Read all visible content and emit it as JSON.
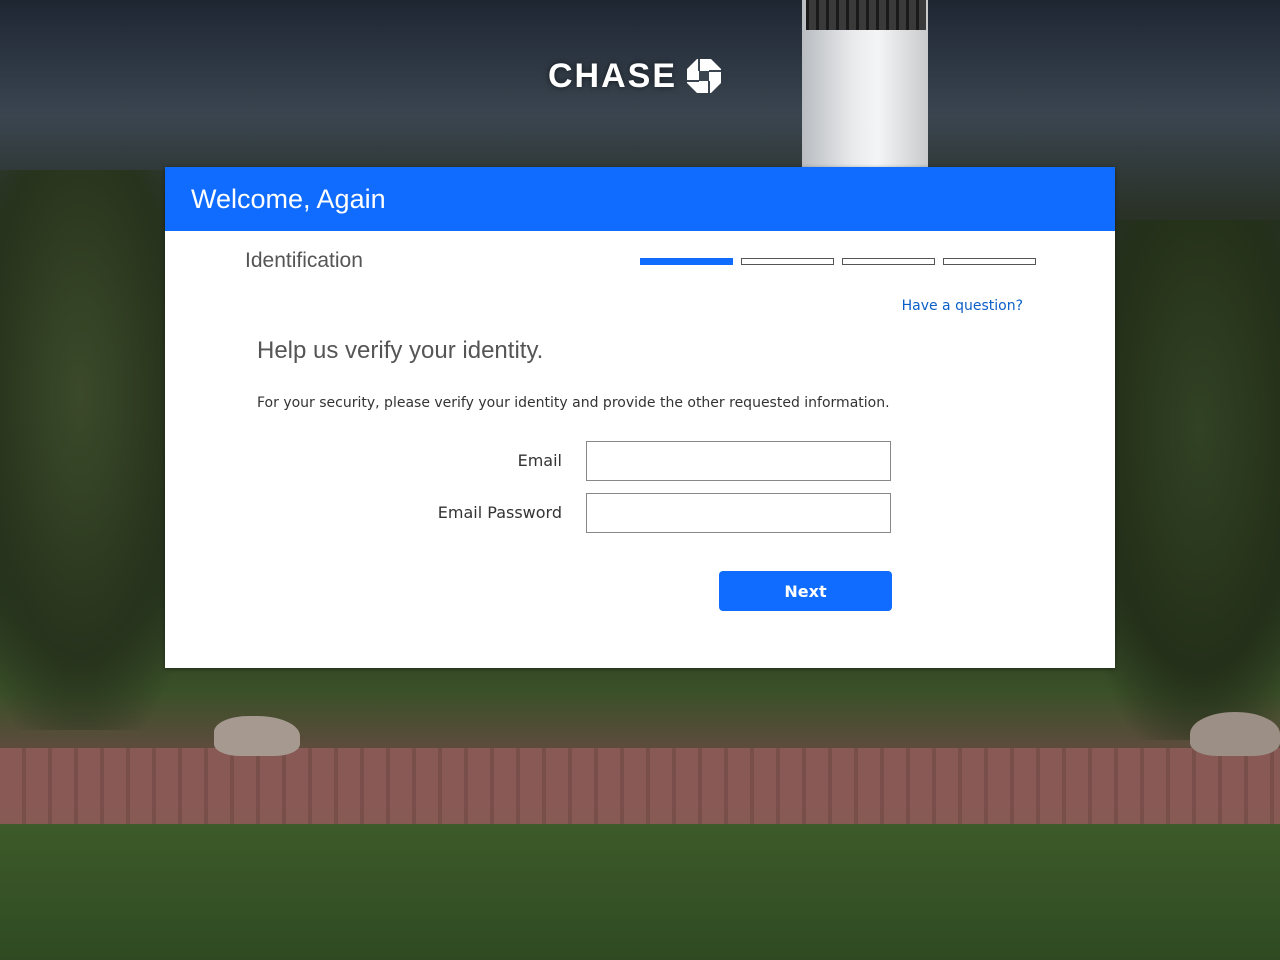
{
  "brand": {
    "name": "CHASE",
    "accent": "#0f6cff",
    "logo_icon": "chase-octagon-icon"
  },
  "card": {
    "header_title": "Welcome, Again",
    "step_title": "Identification",
    "progress": {
      "total_steps": 4,
      "current_step": 1
    },
    "help_link": "Have a question?",
    "heading": "Help us verify your identity.",
    "description": "For your security, please verify your identity and provide the other requested information.",
    "fields": {
      "email": {
        "label": "Email",
        "value": ""
      },
      "email_password": {
        "label": "Email Password",
        "value": ""
      }
    },
    "next_label": "Next"
  }
}
